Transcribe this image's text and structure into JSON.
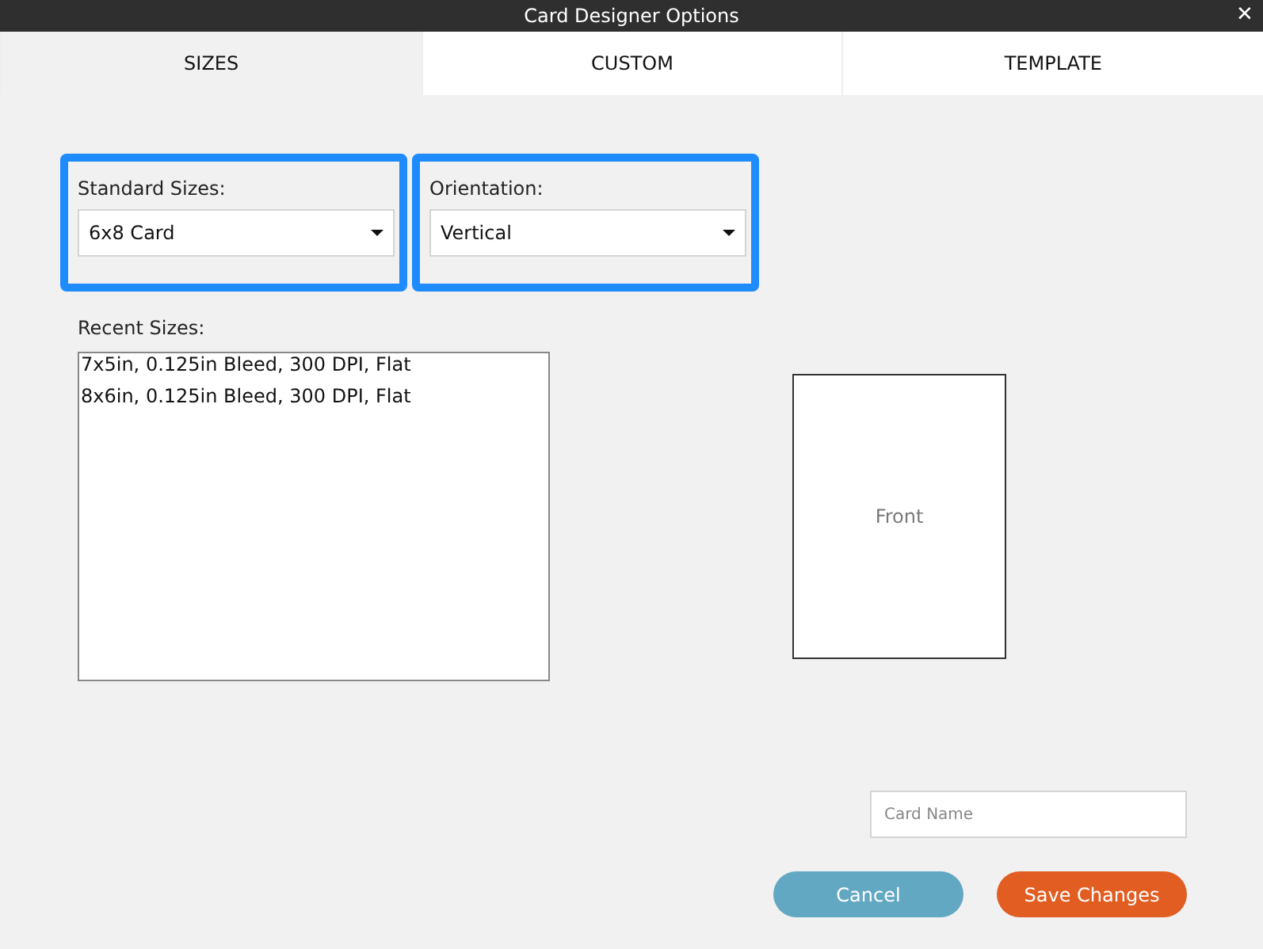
{
  "window": {
    "title": "Card Designer Options",
    "close": "✕"
  },
  "tabs": [
    {
      "label": "SIZES",
      "selected": true
    },
    {
      "label": "CUSTOM",
      "selected": false
    },
    {
      "label": "TEMPLATE",
      "selected": false
    }
  ],
  "selectors": [
    {
      "label": "Standard Sizes:",
      "value": "6x8 Card",
      "highlighted": true
    },
    {
      "label": "Orientation:",
      "value": "Vertical",
      "highlighted": true
    }
  ],
  "recent_sizes": {
    "label": "Recent Sizes:",
    "items": [
      "7x5in, 0.125in Bleed, 300 DPI, Flat",
      "8x6in, 0.125in Bleed, 300 DPI, Flat"
    ]
  },
  "preview": {
    "label": "Front"
  },
  "card_name": {
    "placeholder": "Card Name"
  },
  "buttons": [
    {
      "label": "Cancel",
      "kind": "secondary"
    },
    {
      "label": "Save Changes",
      "kind": "primary"
    }
  ]
}
